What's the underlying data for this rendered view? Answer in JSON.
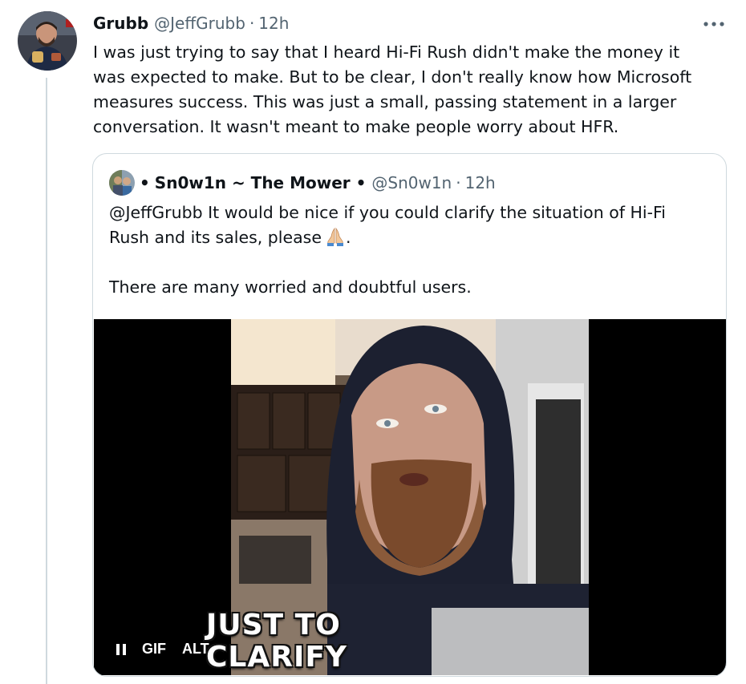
{
  "tweet": {
    "author_name": "Grubb",
    "author_handle": "@JeffGrubb",
    "separator": "·",
    "time": "12h",
    "more_icon": "more-horizontal-icon",
    "text": "I was just trying to say that I heard Hi-Fi Rush didn't make the money it\nwas expected to make. But to be clear, I don't really know how Microsoft\nmeasures success. This was just a small, passing statement in a larger\nconversation. It wasn't meant to make people worry about HFR."
  },
  "quote": {
    "name_prefix": "•",
    "author_name": "Sn0w1n ~ The Mower •",
    "author_handle": "@Sn0w1n",
    "separator": "·",
    "time": "12h",
    "text_line1": "@JeffGrubb It would be nice if you could clarify the situation of Hi-Fi",
    "text_line2": "Rush and its sales, please",
    "text_line2_end": ".",
    "emoji": "folded-hands-icon",
    "text_line3": "There are many worried and doubtful users.",
    "media": {
      "caption": "JUST TO\nCLARIFY",
      "gif_label": "GIF",
      "alt_label": "ALT",
      "pause_icon": "pause-icon"
    }
  },
  "colors": {
    "text_primary": "#0f1419",
    "text_secondary": "#536471",
    "border": "#cfd9de",
    "media_bg": "#000000"
  }
}
